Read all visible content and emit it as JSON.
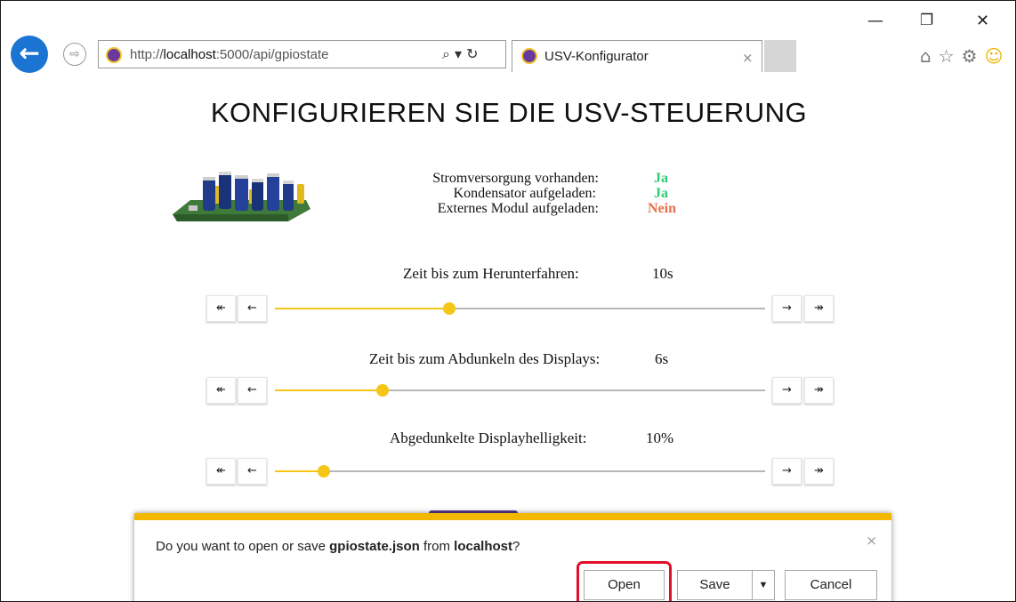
{
  "browser": {
    "window_controls": {
      "minimize": "—",
      "restore": "❐",
      "close": "✕"
    },
    "back_icon": "←",
    "forward_icon": "⇨",
    "address": {
      "url_prefix": "http://",
      "url_host": "localhost",
      "url_rest": ":5000/api/gpiostate"
    },
    "address_tools": "⌕ ▾ ↻",
    "tab": {
      "title": "USV-Konfigurator",
      "close": "×"
    },
    "toolbar_icons": [
      "home-icon",
      "star-icon",
      "gear-icon",
      "smiley-icon"
    ]
  },
  "page": {
    "title": "KONFIGURIEREN SIE DIE USV-STEUERUNG",
    "status": [
      {
        "label": "Stromversorgung vorhanden:",
        "value": "Ja",
        "color": "#2ecc71"
      },
      {
        "label": "Kondensator aufgeladen:",
        "value": "Ja",
        "color": "#2ecc71"
      },
      {
        "label": "Externes Modul aufgeladen:",
        "value": "Nein",
        "color": "#e8704a"
      }
    ],
    "sliders": [
      {
        "label": "Zeit bis zum Herunterfahren:",
        "value": "10s",
        "fraction": 0.355
      },
      {
        "label": "Zeit bis zum Abdunkeln des Displays:",
        "value": "6s",
        "fraction": 0.22
      },
      {
        "label": "Abgedunkelte Displayhelligkeit:",
        "value": "10%",
        "fraction": 0.1
      }
    ],
    "slider_buttons": {
      "first": "↞",
      "prev": "←",
      "next": "→",
      "last": "↠"
    },
    "accent_color": "#f5c518"
  },
  "notification": {
    "text_prefix": "Do you want to open or save ",
    "filename": "gpiostate.json",
    "text_middle": " from ",
    "source": "localhost",
    "text_suffix": "?",
    "close": "×",
    "open_label": "Open",
    "save_label": "Save",
    "dropdown_icon": "▼",
    "cancel_label": "Cancel",
    "bar_color": "#f2b800"
  }
}
